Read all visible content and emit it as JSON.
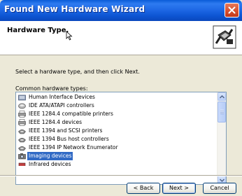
{
  "window": {
    "title": "Found New Hardware Wizard"
  },
  "header": {
    "title": "Hardware Type.",
    "icon": "wizard-hardware-icon"
  },
  "instructions": "Select a hardware type, and then click Next.",
  "list": {
    "label": "Common hardware types:",
    "items": [
      {
        "label": "Human Interface Devices",
        "icon": "hid-icon",
        "selected": false
      },
      {
        "label": "IDE ATA/ATAPI controllers",
        "icon": "ide-controller-icon",
        "selected": false
      },
      {
        "label": "IEEE 1284.4 compatible printers",
        "icon": "printer-port-icon",
        "selected": false
      },
      {
        "label": "IEEE 1284.4 devices",
        "icon": "printer-port-icon",
        "selected": false
      },
      {
        "label": "IEEE 1394 and SCSI printers",
        "icon": "firewire-icon",
        "selected": false
      },
      {
        "label": "IEEE 1394 Bus host controllers",
        "icon": "firewire-icon",
        "selected": false
      },
      {
        "label": "IEEE 1394 IP Network Enumerator",
        "icon": "firewire-icon",
        "selected": false
      },
      {
        "label": "Imaging devices",
        "icon": "camera-icon",
        "selected": true
      },
      {
        "label": "Infrared devices",
        "icon": "infrared-icon",
        "selected": false
      }
    ]
  },
  "buttons": {
    "back": "< Back",
    "next": "Next >",
    "cancel": "Cancel"
  },
  "colors": {
    "titlebar": "#0a5bd8",
    "selection": "#316ac5",
    "window_bg": "#ece9d8"
  }
}
